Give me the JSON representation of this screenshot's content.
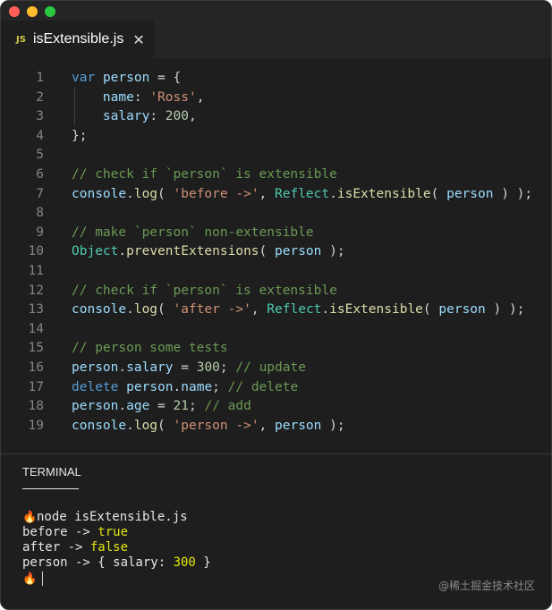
{
  "window": {
    "controls": [
      "close",
      "minimize",
      "maximize"
    ]
  },
  "tab": {
    "badge": "JS",
    "title": "isExtensible.js",
    "close_glyph": "✕"
  },
  "code": {
    "lines": [
      {
        "n": "1",
        "tokens": [
          [
            "kw",
            "var"
          ],
          [
            "punc",
            " "
          ],
          [
            "var",
            "person"
          ],
          [
            "punc",
            " = {"
          ]
        ]
      },
      {
        "n": "2",
        "tokens": [
          [
            "punc",
            "    "
          ],
          [
            "var",
            "name"
          ],
          [
            "punc",
            ": "
          ],
          [
            "str",
            "'Ross'"
          ],
          [
            "punc",
            ","
          ]
        ]
      },
      {
        "n": "3",
        "tokens": [
          [
            "punc",
            "    "
          ],
          [
            "var",
            "salary"
          ],
          [
            "punc",
            ": "
          ],
          [
            "num",
            "200"
          ],
          [
            "punc",
            ","
          ]
        ]
      },
      {
        "n": "4",
        "tokens": [
          [
            "punc",
            "};"
          ]
        ]
      },
      {
        "n": "5",
        "tokens": []
      },
      {
        "n": "6",
        "tokens": [
          [
            "com",
            "// check if `person` is extensible"
          ]
        ]
      },
      {
        "n": "7",
        "tokens": [
          [
            "var",
            "console"
          ],
          [
            "punc",
            "."
          ],
          [
            "fn",
            "log"
          ],
          [
            "punc",
            "( "
          ],
          [
            "str",
            "'before ->'"
          ],
          [
            "punc",
            ", "
          ],
          [
            "cls",
            "Reflect"
          ],
          [
            "punc",
            "."
          ],
          [
            "fn",
            "isExtensible"
          ],
          [
            "punc",
            "( "
          ],
          [
            "var",
            "person"
          ],
          [
            "punc",
            " ) );"
          ]
        ]
      },
      {
        "n": "8",
        "tokens": []
      },
      {
        "n": "9",
        "tokens": [
          [
            "com",
            "// make `person` non-extensible"
          ]
        ]
      },
      {
        "n": "10",
        "tokens": [
          [
            "cls",
            "Object"
          ],
          [
            "punc",
            "."
          ],
          [
            "fn",
            "preventExtensions"
          ],
          [
            "punc",
            "( "
          ],
          [
            "var",
            "person"
          ],
          [
            "punc",
            " );"
          ]
        ]
      },
      {
        "n": "11",
        "tokens": []
      },
      {
        "n": "12",
        "tokens": [
          [
            "com",
            "// check if `person` is extensible"
          ]
        ]
      },
      {
        "n": "13",
        "tokens": [
          [
            "var",
            "console"
          ],
          [
            "punc",
            "."
          ],
          [
            "fn",
            "log"
          ],
          [
            "punc",
            "( "
          ],
          [
            "str",
            "'after ->'"
          ],
          [
            "punc",
            ", "
          ],
          [
            "cls",
            "Reflect"
          ],
          [
            "punc",
            "."
          ],
          [
            "fn",
            "isExtensible"
          ],
          [
            "punc",
            "( "
          ],
          [
            "var",
            "person"
          ],
          [
            "punc",
            " ) );"
          ]
        ]
      },
      {
        "n": "14",
        "tokens": []
      },
      {
        "n": "15",
        "tokens": [
          [
            "com",
            "// person some tests"
          ]
        ]
      },
      {
        "n": "16",
        "tokens": [
          [
            "var",
            "person"
          ],
          [
            "punc",
            "."
          ],
          [
            "var",
            "salary"
          ],
          [
            "punc",
            " = "
          ],
          [
            "num",
            "300"
          ],
          [
            "punc",
            "; "
          ],
          [
            "com",
            "// update"
          ]
        ]
      },
      {
        "n": "17",
        "tokens": [
          [
            "kw",
            "delete"
          ],
          [
            "punc",
            " "
          ],
          [
            "var",
            "person"
          ],
          [
            "punc",
            "."
          ],
          [
            "var",
            "name"
          ],
          [
            "punc",
            "; "
          ],
          [
            "com",
            "// delete"
          ]
        ]
      },
      {
        "n": "18",
        "tokens": [
          [
            "var",
            "person"
          ],
          [
            "punc",
            "."
          ],
          [
            "var",
            "age"
          ],
          [
            "punc",
            " = "
          ],
          [
            "num",
            "21"
          ],
          [
            "punc",
            "; "
          ],
          [
            "com",
            "// add"
          ]
        ]
      },
      {
        "n": "19",
        "tokens": [
          [
            "var",
            "console"
          ],
          [
            "punc",
            "."
          ],
          [
            "fn",
            "log"
          ],
          [
            "punc",
            "( "
          ],
          [
            "str",
            "'person ->'"
          ],
          [
            "punc",
            ", "
          ],
          [
            "var",
            "person"
          ],
          [
            "punc",
            " );"
          ]
        ]
      }
    ]
  },
  "terminal": {
    "tab_label": "TERMINAL",
    "command": "node isExtensible.js",
    "output": [
      [
        [
          "plain",
          "before -> "
        ],
        [
          "yellow",
          "true"
        ]
      ],
      [
        [
          "plain",
          "after -> "
        ],
        [
          "yellow",
          "false"
        ]
      ],
      [
        [
          "plain",
          "person -> { salary: "
        ],
        [
          "yellow",
          "300"
        ],
        [
          "plain",
          " }"
        ]
      ]
    ]
  },
  "watermark": "@稀土掘金技术社区",
  "colors": {
    "keyword": "#569cd6",
    "variable": "#9cdcfe",
    "string": "#ce9178",
    "number": "#b5cea8",
    "comment": "#6a9955",
    "function": "#dcdcaa",
    "class": "#4ec9b0",
    "terminal_value": "#e5e510"
  }
}
